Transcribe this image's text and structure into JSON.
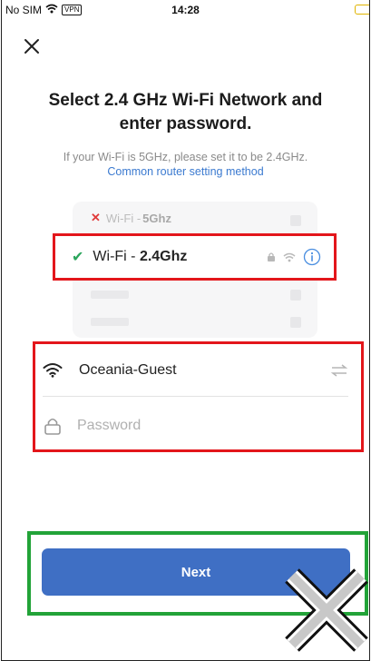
{
  "status_bar": {
    "carrier": "No SIM",
    "vpn": "VPN",
    "time": "14:28"
  },
  "header": {
    "title": "Select 2.4 GHz Wi-Fi Network and enter password.",
    "subtitle": "If your Wi-Fi is 5GHz, please set it to be 2.4GHz.",
    "router_link": "Common router setting method"
  },
  "illustration": {
    "band_5g_prefix": "Wi-Fi - ",
    "band_5g_value": "5Ghz",
    "band_24_prefix": "Wi-Fi - ",
    "band_24_value": "2.4Ghz"
  },
  "form": {
    "ssid": "Oceania-Guest",
    "password_placeholder": "Password"
  },
  "next_label": "Next",
  "colors": {
    "accent": "#3f6fc4",
    "link": "#3b7ad0",
    "highlight_red": "#e3161b",
    "highlight_green": "#22a338"
  }
}
